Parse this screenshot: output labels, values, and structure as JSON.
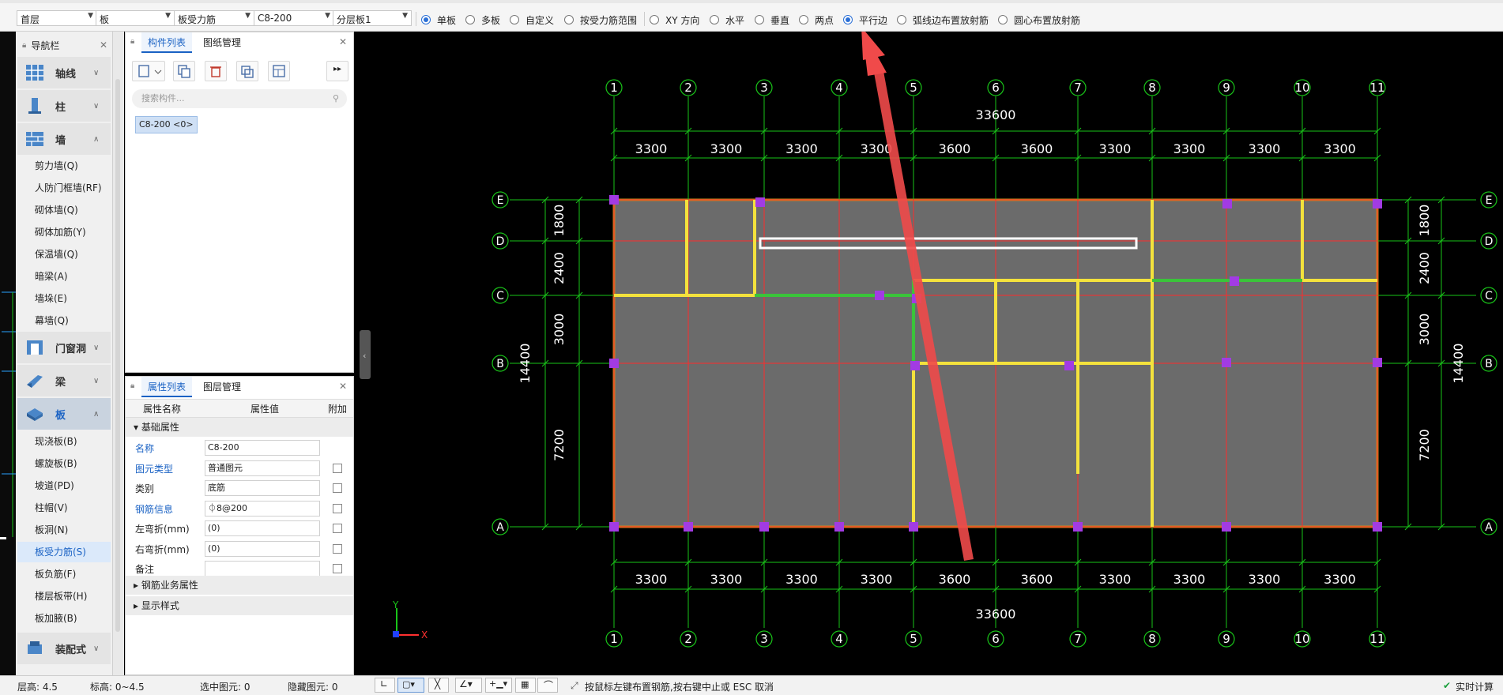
{
  "toolbar": {
    "floor": "首层",
    "category": "板",
    "type": "板受力筋",
    "component": "C8-200",
    "layer": "分层板1",
    "scope_options": [
      {
        "label": "单板",
        "checked": true
      },
      {
        "label": "多板",
        "checked": false
      },
      {
        "label": "自定义",
        "checked": false
      },
      {
        "label": "按受力筋范围",
        "checked": false
      }
    ],
    "direction_options": [
      {
        "label": "XY 方向",
        "checked": false
      },
      {
        "label": "水平",
        "checked": false
      },
      {
        "label": "垂直",
        "checked": false
      },
      {
        "label": "两点",
        "checked": false
      },
      {
        "label": "平行边",
        "checked": true
      },
      {
        "label": "弧线边布置放射筋",
        "checked": false
      },
      {
        "label": "圆心布置放射筋",
        "checked": false
      }
    ]
  },
  "navigator": {
    "title": "导航栏",
    "categories": {
      "axis": "轴线",
      "column": "柱",
      "wall": "墙",
      "opening": "门窗洞",
      "beam": "梁",
      "slab": "板",
      "prefab": "装配式"
    },
    "wall_items": [
      "剪力墙(Q)",
      "人防门框墙(RF)",
      "砌体墙(Q)",
      "砌体加筋(Y)",
      "保温墙(Q)",
      "暗梁(A)",
      "墙垛(E)",
      "幕墙(Q)"
    ],
    "slab_items": [
      "现浇板(B)",
      "螺旋板(B)",
      "坡道(PD)",
      "柱帽(V)",
      "板洞(N)",
      "板受力筋(S)",
      "板负筋(F)",
      "楼层板带(H)",
      "板加腋(B)"
    ],
    "selected": "板受力筋(S)"
  },
  "component_panel": {
    "tabs": [
      "构件列表",
      "图纸管理"
    ],
    "search_placeholder": "搜索构件...",
    "item": "C8-200 <0>"
  },
  "property_panel": {
    "tabs": [
      "属性列表",
      "图层管理"
    ],
    "headers": [
      "属性名称",
      "属性值",
      "附加"
    ],
    "group_basic": "基础属性",
    "rows": [
      {
        "name": "名称",
        "value": "C8-200",
        "blue": true,
        "check": false
      },
      {
        "name": "图元类型",
        "value": "普通图元",
        "blue": true,
        "check": true
      },
      {
        "name": "类别",
        "value": "底筋",
        "blue": false,
        "check": true
      },
      {
        "name": "钢筋信息",
        "value": "⏀8@200",
        "blue": true,
        "check": true
      },
      {
        "name": "左弯折(mm)",
        "value": "(0)",
        "blue": false,
        "check": true
      },
      {
        "name": "右弯折(mm)",
        "value": "(0)",
        "blue": false,
        "check": true
      },
      {
        "name": "备注",
        "value": "",
        "blue": false,
        "check": true
      }
    ],
    "group_rebar": "钢筋业务属性",
    "group_display": "显示样式"
  },
  "status": {
    "floor_height": "层高:  4.5",
    "elevation": "标高:   0~4.5",
    "selected": "选中图元:  0",
    "hidden": "隐藏图元:  0",
    "hint": "按鼠标左键布置钢筋,按右键中止或 ESC 取消",
    "realtime": "实时计算"
  },
  "drawing": {
    "x_axes": [
      "1",
      "2",
      "3",
      "4",
      "5",
      "6",
      "7",
      "8",
      "9",
      "10",
      "11"
    ],
    "y_axes": [
      "A",
      "B",
      "C",
      "D",
      "E"
    ],
    "x_total": "33600",
    "x_spans": [
      "3300",
      "3300",
      "3300",
      "3300",
      "3600",
      "3600",
      "3300",
      "3300",
      "3300",
      "3300"
    ],
    "y_spans": [
      "7200",
      "3000",
      "2400",
      "1800"
    ],
    "y_total": "14400",
    "ucs_x": "X",
    "ucs_y": "Y",
    "colors": {
      "axis": "#ff2b2b",
      "slab": "#6b6b6b",
      "border": "#c88a1c",
      "wall": "#f4e23c",
      "rebar": "#3ac43a",
      "column": "#a23be3",
      "dim": "#19c419",
      "arrow": "#f04a4a"
    }
  }
}
